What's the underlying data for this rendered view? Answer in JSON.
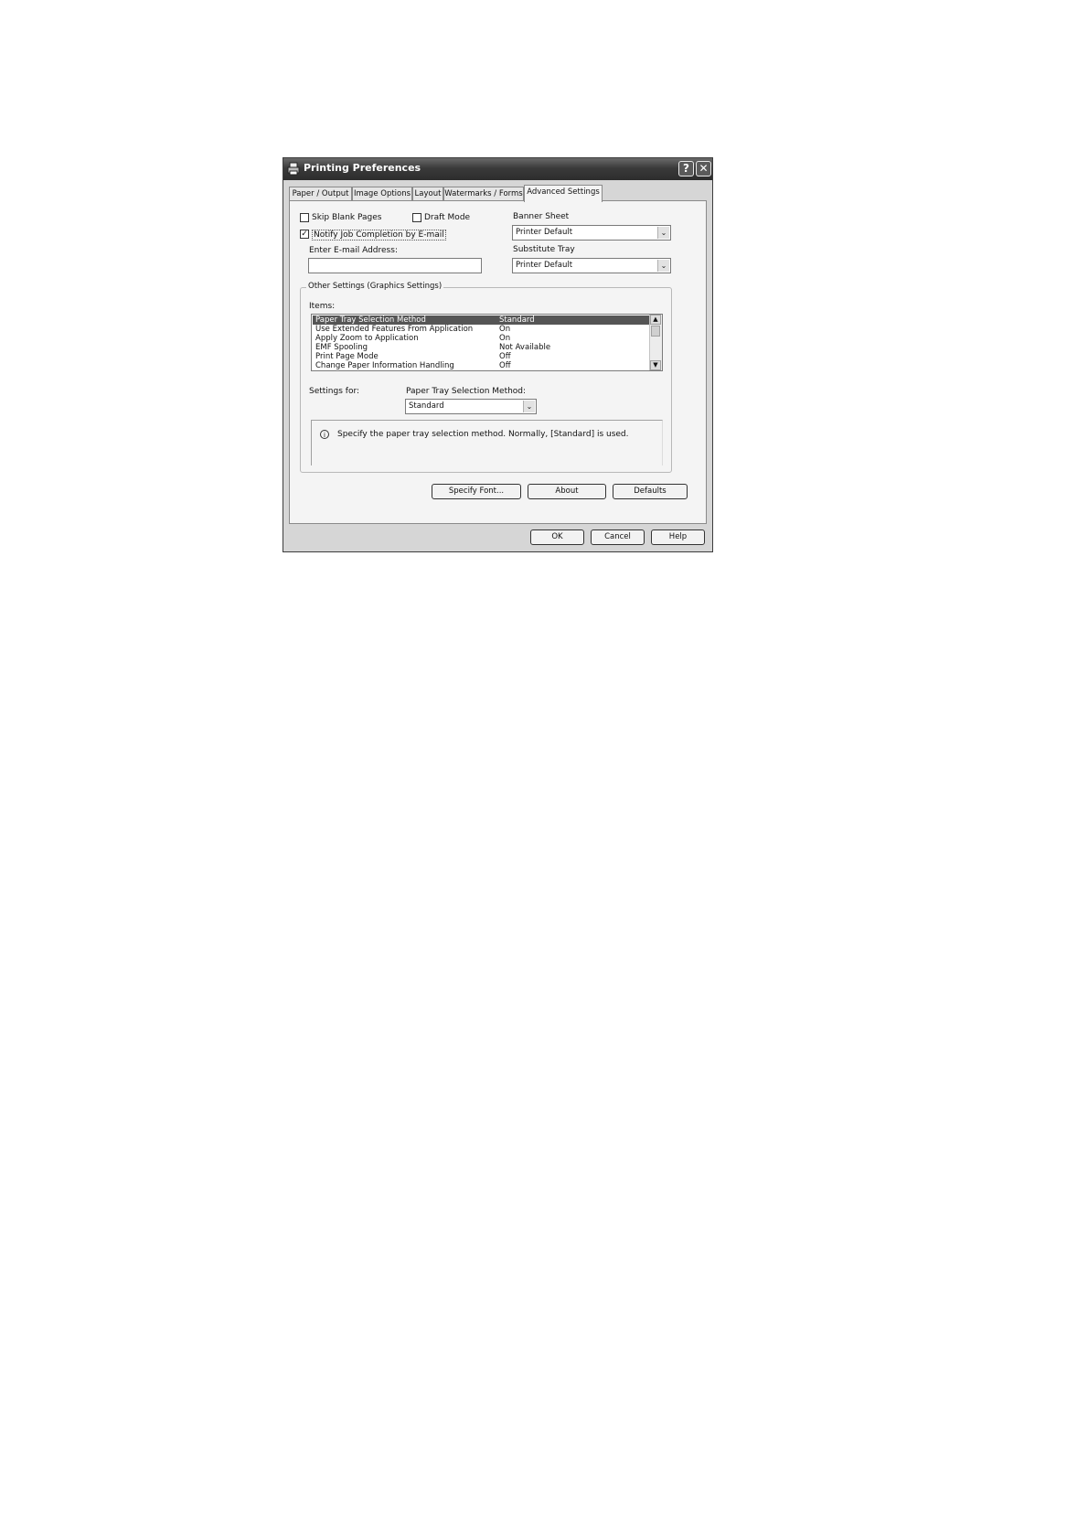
{
  "dialog": {
    "title": "Printing Preferences",
    "help_button": "?",
    "close_button": "✕"
  },
  "tabs": [
    {
      "label": "Paper / Output"
    },
    {
      "label": "Image Options"
    },
    {
      "label": "Layout"
    },
    {
      "label": "Watermarks / Forms"
    },
    {
      "label": "Advanced Settings",
      "active": true
    }
  ],
  "options": {
    "skip_blank_pages": {
      "label": "Skip Blank Pages",
      "checked": false
    },
    "draft_mode": {
      "label": "Draft Mode",
      "checked": false
    },
    "notify_job_completion": {
      "label": "Notify Job Completion by E-mail",
      "checked": true,
      "check_mark": "✓"
    },
    "email_label": "Enter E-mail Address:",
    "email_value": ""
  },
  "banner_sheet": {
    "label": "Banner Sheet",
    "value": "Printer Default"
  },
  "substitute_tray": {
    "label": "Substitute Tray",
    "value": "Printer Default"
  },
  "other_settings": {
    "legend": "Other Settings (Graphics Settings)",
    "items_label": "Items:",
    "items": [
      {
        "name": "Paper Tray Selection Method",
        "value": "Standard",
        "selected": true
      },
      {
        "name": "Use Extended Features From Application",
        "value": "On"
      },
      {
        "name": "Apply Zoom to Application",
        "value": "On"
      },
      {
        "name": "EMF Spooling",
        "value": "Not Available"
      },
      {
        "name": "Print Page Mode",
        "value": "Off"
      },
      {
        "name": "Change Paper Information Handling",
        "value": "Off"
      }
    ],
    "settings_for_label": "Settings for:",
    "method_label": "Paper Tray Selection Method:",
    "method_value": "Standard",
    "info_icon": "i",
    "info_text": "Specify the paper tray selection method. Normally, [Standard] is used."
  },
  "panel_buttons": {
    "specify_font": "Specify Font...",
    "about": "About",
    "defaults": "Defaults"
  },
  "dialog_buttons": {
    "ok": "OK",
    "cancel": "Cancel",
    "help": "Help"
  },
  "icons": {
    "dropdown": "chevron-down-icon",
    "scroll_up": "▲",
    "scroll_down": "▼",
    "dropdown_glyph": "⌄"
  }
}
